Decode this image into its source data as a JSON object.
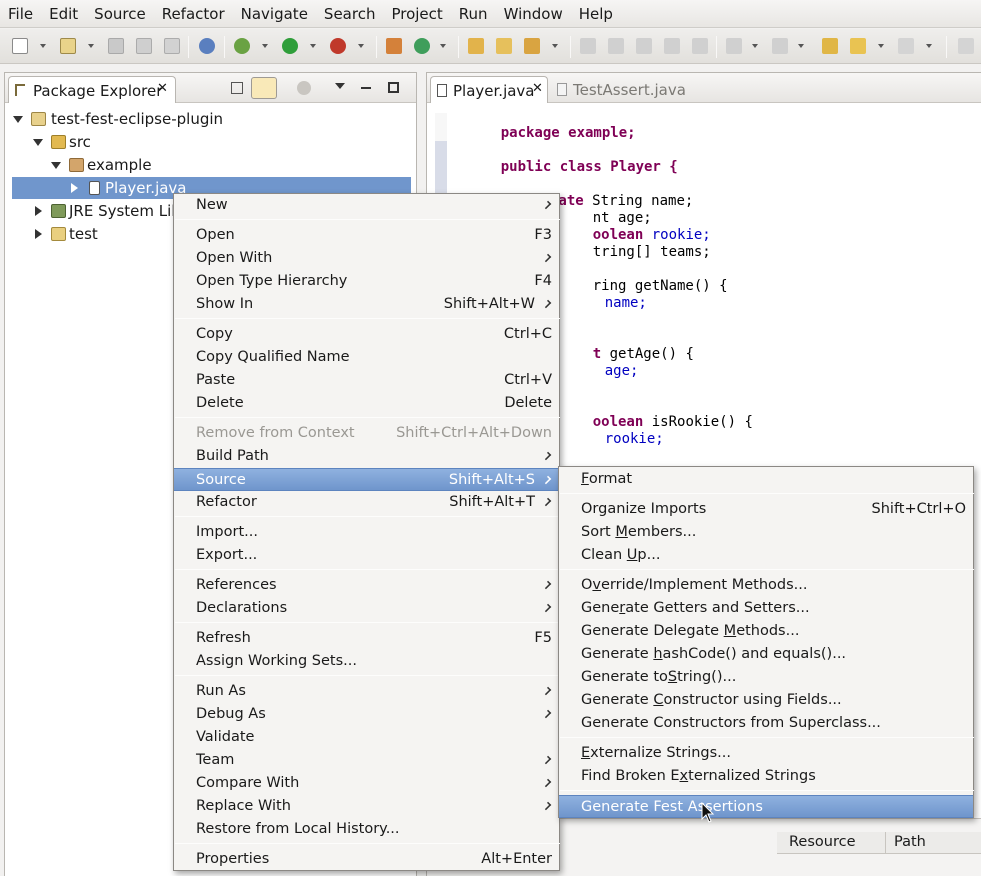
{
  "menubar": [
    "File",
    "Edit",
    "Source",
    "Refactor",
    "Navigate",
    "Search",
    "Project",
    "Run",
    "Window",
    "Help"
  ],
  "explorer": {
    "title": "Package Explorer",
    "tree": [
      "test-fest-eclipse-plugin",
      "src",
      "example",
      "Player.java",
      "JRE System Libr",
      "test"
    ]
  },
  "editor": {
    "tabs": [
      "Player.java",
      "TestAssert.java"
    ],
    "code": {
      "l1": "package example;",
      "l2": "public class Player {",
      "l3_kw": "private",
      "l3_rest": " String name;",
      "l4": "nt age;",
      "l5_kw": "oolean",
      "l5_rest": " rookie;",
      "l6": "tring[] teams;",
      "l7": "ring getName() {",
      "l8": "name;",
      "l9_kw": "t",
      "l9_rest": " getAge() {",
      "l10": "age;",
      "l11_kw": "oolean",
      "l11_rest": " isRookie() {",
      "l12": "rookie;"
    },
    "bottom_cols": [
      "Resource",
      "Path"
    ]
  },
  "context_menu": [
    {
      "label": "New",
      "shortcut": "",
      "submenu": true
    },
    {
      "label": "Open",
      "shortcut": "F3",
      "submenu": false
    },
    {
      "label": "Open With",
      "shortcut": "",
      "submenu": true
    },
    {
      "label": "Open Type Hierarchy",
      "shortcut": "F4",
      "submenu": false
    },
    {
      "label": "Show In",
      "shortcut": "Shift+Alt+W",
      "submenu": true
    },
    {
      "label": "Copy",
      "shortcut": "Ctrl+C",
      "submenu": false
    },
    {
      "label": "Copy Qualified Name",
      "shortcut": "",
      "submenu": false
    },
    {
      "label": "Paste",
      "shortcut": "Ctrl+V",
      "submenu": false
    },
    {
      "label": "Delete",
      "shortcut": "Delete",
      "submenu": false
    },
    {
      "label": "Remove from Context",
      "shortcut": "Shift+Ctrl+Alt+Down",
      "submenu": false
    },
    {
      "label": "Build Path",
      "shortcut": "",
      "submenu": true
    },
    {
      "label": "Source",
      "shortcut": "Shift+Alt+S",
      "submenu": true
    },
    {
      "label": "Refactor",
      "shortcut": "Shift+Alt+T",
      "submenu": true
    },
    {
      "label": "Import...",
      "shortcut": "",
      "submenu": false
    },
    {
      "label": "Export...",
      "shortcut": "",
      "submenu": false
    },
    {
      "label": "References",
      "shortcut": "",
      "submenu": true
    },
    {
      "label": "Declarations",
      "shortcut": "",
      "submenu": true
    },
    {
      "label": "Refresh",
      "shortcut": "F5",
      "submenu": false
    },
    {
      "label": "Assign Working Sets...",
      "shortcut": "",
      "submenu": false
    },
    {
      "label": "Run As",
      "shortcut": "",
      "submenu": true
    },
    {
      "label": "Debug As",
      "shortcut": "",
      "submenu": true
    },
    {
      "label": "Validate",
      "shortcut": "",
      "submenu": false
    },
    {
      "label": "Team",
      "shortcut": "",
      "submenu": true
    },
    {
      "label": "Compare With",
      "shortcut": "",
      "submenu": true
    },
    {
      "label": "Replace With",
      "shortcut": "",
      "submenu": true
    },
    {
      "label": "Restore from Local History...",
      "shortcut": "",
      "submenu": false
    },
    {
      "label": "Properties",
      "shortcut": "Alt+Enter",
      "submenu": false
    }
  ],
  "source_submenu": [
    {
      "pre": "",
      "u": "F",
      "post": "ormat",
      "shortcut": ""
    },
    {
      "pre": "Organize Imports",
      "u": "",
      "post": "",
      "shortcut": "Shift+Ctrl+O"
    },
    {
      "pre": "Sort ",
      "u": "M",
      "post": "embers...",
      "shortcut": ""
    },
    {
      "pre": "Clean ",
      "u": "U",
      "post": "p...",
      "shortcut": ""
    },
    {
      "pre": "O",
      "u": "v",
      "post": "erride/Implement Methods...",
      "shortcut": ""
    },
    {
      "pre": "Gene",
      "u": "r",
      "post": "ate Getters and Setters...",
      "shortcut": ""
    },
    {
      "pre": "Generate Delegate ",
      "u": "M",
      "post": "ethods...",
      "shortcut": ""
    },
    {
      "pre": "Generate ",
      "u": "h",
      "post": "ashCode() and equals()...",
      "shortcut": ""
    },
    {
      "pre": "Generate to",
      "u": "S",
      "post": "tring()...",
      "shortcut": ""
    },
    {
      "pre": "Generate ",
      "u": "C",
      "post": "onstructor using Fields...",
      "shortcut": ""
    },
    {
      "pre": "Generate Constructors from Superclass...",
      "u": "",
      "post": "",
      "shortcut": ""
    },
    {
      "pre": "",
      "u": "E",
      "post": "xternalize Strings...",
      "shortcut": ""
    },
    {
      "pre": "Find Broken E",
      "u": "x",
      "post": "ternalized Strings",
      "shortcut": ""
    },
    {
      "pre": "Generate Fest Assertions",
      "u": "",
      "post": "",
      "shortcut": ""
    }
  ]
}
